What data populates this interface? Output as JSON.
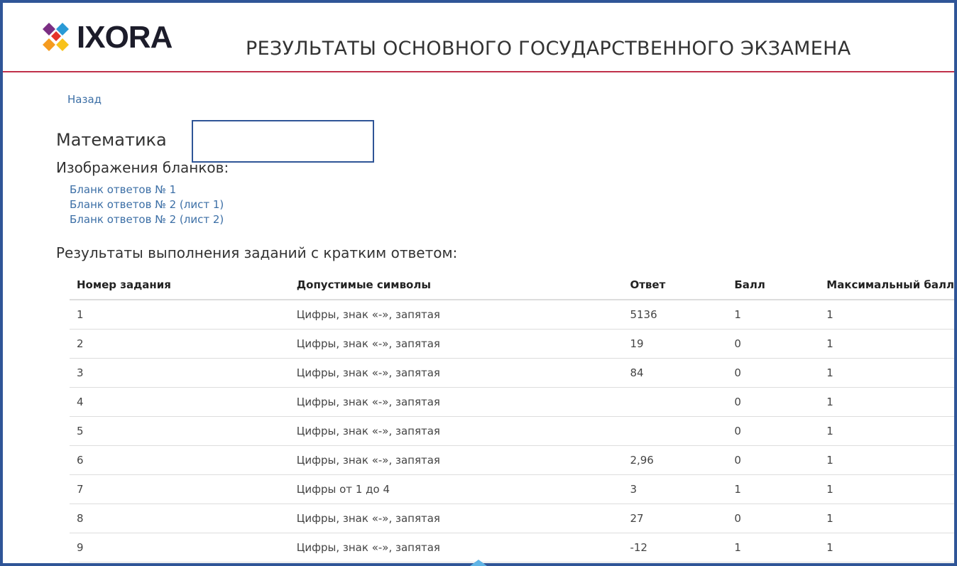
{
  "header": {
    "logo_text": "IXORA",
    "title": "РЕЗУЛЬТАТЫ ОСНОВНОГО ГОСУДАРСТВЕННОГО ЭКЗАМЕНА"
  },
  "nav": {
    "back_label": "Назад"
  },
  "subject": {
    "title": "Математика"
  },
  "images": {
    "title": "Изображения бланков:",
    "forms": [
      "Бланк ответов № 1",
      "Бланк ответов № 2 (лист 1)",
      "Бланк ответов № 2 (лист 2)"
    ]
  },
  "results": {
    "title": "Результаты выполнения заданий с кратким ответом:",
    "columns": [
      "Номер задания",
      "Допустимые символы",
      "Ответ",
      "Балл",
      "Максимальный балл"
    ],
    "rows": [
      [
        "1",
        "Цифры, знак «-», запятая",
        "5136",
        "1",
        "1"
      ],
      [
        "2",
        "Цифры, знак «-», запятая",
        "19",
        "0",
        "1"
      ],
      [
        "3",
        "Цифры, знак «-», запятая",
        "84",
        "0",
        "1"
      ],
      [
        "4",
        "Цифры, знак «-», запятая",
        "",
        "0",
        "1"
      ],
      [
        "5",
        "Цифры, знак «-», запятая",
        "",
        "0",
        "1"
      ],
      [
        "6",
        "Цифры, знак «-», запятая",
        "2,96",
        "0",
        "1"
      ],
      [
        "7",
        "Цифры от 1 до 4",
        "3",
        "1",
        "1"
      ],
      [
        "8",
        "Цифры, знак «-», запятая",
        "27",
        "0",
        "1"
      ],
      [
        "9",
        "Цифры, знак «-», запятая",
        "-12",
        "1",
        "1"
      ]
    ]
  },
  "colors": {
    "link": "#3c6fa6",
    "header_rule": "#c0304a",
    "frame": "#2f5597",
    "logo_orange": "#f59b1f",
    "logo_purple": "#7b2e83",
    "logo_blue": "#2a9ad6",
    "logo_yellow": "#f8c21b"
  }
}
